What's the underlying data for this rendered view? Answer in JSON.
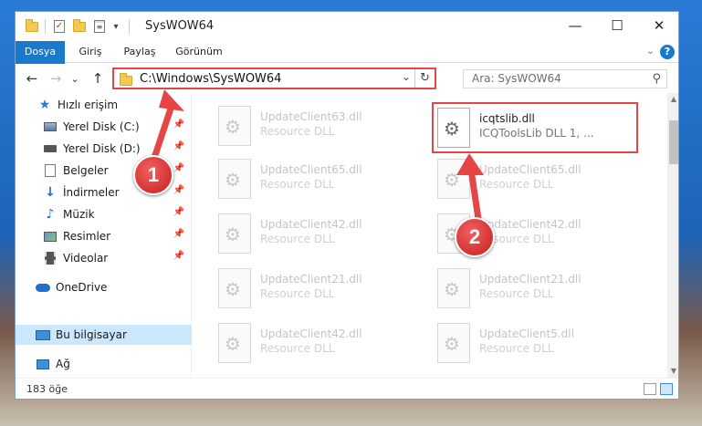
{
  "window": {
    "title": "SysWOW64",
    "controls": {
      "minimize": "—",
      "maximize": "☐",
      "close": "✕"
    }
  },
  "quick_access_toolbar": {
    "dropdown": "▾"
  },
  "ribbon": {
    "tabs": [
      {
        "label": "Dosya"
      },
      {
        "label": "Giriş"
      },
      {
        "label": "Paylaş"
      },
      {
        "label": "Görünüm"
      }
    ],
    "collapse": "⌄",
    "help": "?"
  },
  "navigation": {
    "back": "←",
    "forward": "→",
    "recent": "⌄",
    "up": "↑"
  },
  "address_bar": {
    "path": "C:\\Windows\\SysWOW64",
    "dropdown": "⌄",
    "refresh": "↻"
  },
  "search": {
    "placeholder": "Ara: SysWOW64",
    "icon": "search-icon"
  },
  "sidebar": {
    "items": [
      {
        "label": "Hızlı erişim",
        "icon": "star-icon"
      },
      {
        "label": "Yerel Disk (C:)",
        "icon": "drive-icon",
        "pinned": true
      },
      {
        "label": "Yerel Disk (D:)",
        "icon": "disk-icon",
        "pinned": true
      },
      {
        "label": "Belgeler",
        "icon": "documents-icon",
        "pinned": true
      },
      {
        "label": "İndirmeler",
        "icon": "download-icon",
        "pinned": true
      },
      {
        "label": "Müzik",
        "icon": "music-icon",
        "pinned": true
      },
      {
        "label": "Resimler",
        "icon": "pictures-icon",
        "pinned": true
      },
      {
        "label": "Videolar",
        "icon": "videos-icon",
        "pinned": true
      },
      {
        "label": "OneDrive",
        "icon": "onedrive-icon"
      },
      {
        "label": "Bu bilgisayar",
        "icon": "this-pc-icon",
        "selected": true
      },
      {
        "label": "Ağ",
        "icon": "network-icon"
      }
    ],
    "pin_glyph": "📌"
  },
  "files": {
    "highlighted": {
      "name": "icqtslib.dll",
      "description": "ICQToolsLib DLL 1, ..."
    },
    "left_column": [
      {
        "name": "UpdateClient63.dll",
        "description": "Resource DLL"
      },
      {
        "name": "UpdateClient65.dll",
        "description": "Resource DLL"
      },
      {
        "name": "UpdateClient42.dll",
        "description": "Resource DLL"
      },
      {
        "name": "UpdateClient21.dll",
        "description": "Resource DLL"
      },
      {
        "name": "UpdateClient42.dll",
        "description": "Resource DLL"
      }
    ],
    "right_column": [
      {
        "name": "UpdateClient65.dll",
        "description": "Resource DLL"
      },
      {
        "name": "UpdateClient42.dll",
        "description": "Resource DLL"
      },
      {
        "name": "UpdateClient21.dll",
        "description": "Resource DLL"
      },
      {
        "name": "UpdateClient5.dll",
        "description": "Resource DLL"
      }
    ]
  },
  "status_bar": {
    "item_count": "183 öğe"
  },
  "annotations": {
    "step1": "1",
    "step2": "2",
    "color": "#e64545"
  }
}
